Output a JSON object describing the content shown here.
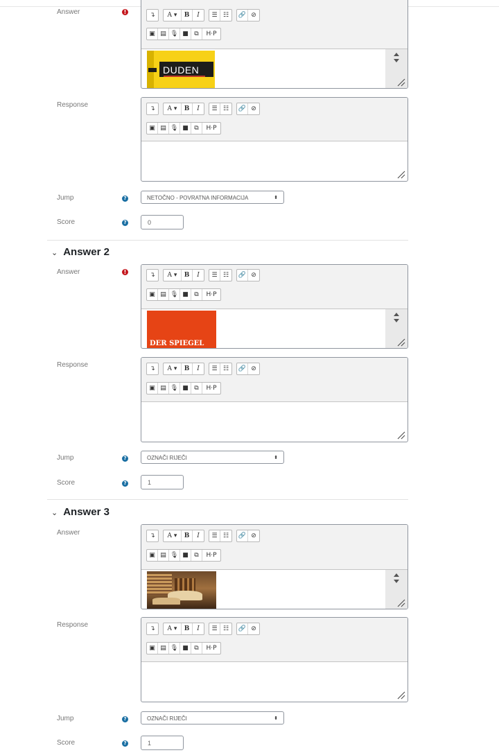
{
  "labels": {
    "answer": "Answer",
    "response": "Response",
    "jump": "Jump",
    "score": "Score"
  },
  "icons": {
    "required": "!",
    "help": "?"
  },
  "toolbar": {
    "row1": [
      {
        "name": "indent-icon",
        "glyph": "↴"
      },
      {
        "name": "font-size-icon",
        "glyph": "A ▾"
      },
      {
        "name": "bold-icon",
        "glyph": "B"
      },
      {
        "name": "italic-icon",
        "glyph": "I"
      },
      {
        "name": "unordered-list-icon",
        "glyph": "☰"
      },
      {
        "name": "ordered-list-icon",
        "glyph": "☷"
      },
      {
        "name": "link-icon",
        "glyph": "🔗"
      },
      {
        "name": "unlink-icon",
        "glyph": "⊘"
      }
    ],
    "row2": [
      {
        "name": "image-icon",
        "glyph": "▣"
      },
      {
        "name": "media-icon",
        "glyph": "▤"
      },
      {
        "name": "microphone-icon",
        "glyph": "🎙"
      },
      {
        "name": "video-icon",
        "glyph": "■"
      },
      {
        "name": "manage-files-icon",
        "glyph": "⧉"
      },
      {
        "name": "h5p-icon",
        "glyph": "H·P"
      }
    ]
  },
  "sections": [
    {
      "heading": "",
      "answer_image": "DUDEN",
      "jump": "NETOČNO - POVRATNA INFORMACIJA",
      "score": "0"
    },
    {
      "heading": "Answer 2",
      "answer_image": "DER SPIEGEL",
      "jump": "OZNAČI RIJEČI",
      "score": "1"
    },
    {
      "heading": "Answer 3",
      "answer_image": "books",
      "jump": "OZNAČI RIJEČI",
      "score": "1"
    }
  ],
  "colors": {
    "required": "#c4161c",
    "help": "#1a6fa3",
    "spiegel": "#e64415",
    "duden_yellow": "#f7d117"
  }
}
